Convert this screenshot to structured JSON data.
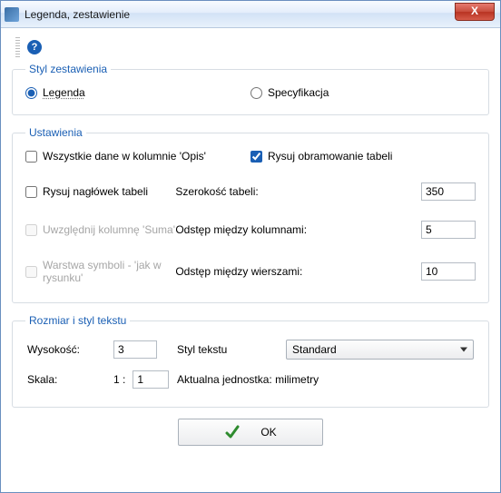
{
  "window": {
    "title": "Legenda, zestawienie",
    "close": "X"
  },
  "help_label": "?",
  "group_style": {
    "legend": "Styl zestawienia",
    "option_legenda": "Legenda",
    "option_spec": "Specyfikacja"
  },
  "group_settings": {
    "legend": "Ustawienia",
    "all_data_opis": "Wszystkie dane w kolumnie 'Opis'",
    "draw_border": "Rysuj obramowanie tabeli",
    "draw_header": "Rysuj nagłówek tabeli",
    "width_label": "Szerokość tabeli:",
    "width_value": "350",
    "include_suma": "Uwzględnij kolumnę 'Suma'",
    "col_spacing_label": "Odstęp między kolumnami:",
    "col_spacing_value": "5",
    "symbol_layer": "Warstwa symboli - 'jak w rysunku'",
    "row_spacing_label": "Odstęp między wierszami:",
    "row_spacing_value": "10"
  },
  "group_text": {
    "legend": "Rozmiar i styl tekstu",
    "height_label": "Wysokość:",
    "height_value": "3",
    "style_label": "Styl tekstu",
    "style_value": "Standard",
    "scale_label": "Skala:",
    "scale_prefix": "1 :",
    "scale_value": "1",
    "unit_label": "Aktualna jednostka: milimetry"
  },
  "footer": {
    "ok": "OK"
  }
}
